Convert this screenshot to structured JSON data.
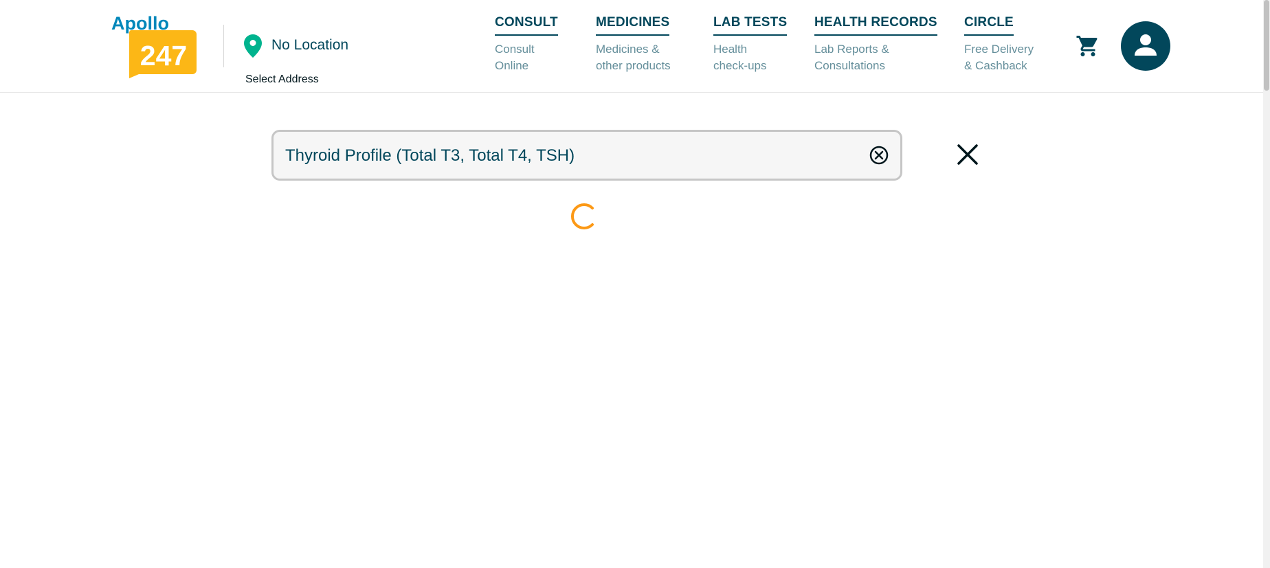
{
  "brand": {
    "logo_top": "Apollo",
    "logo_number": "247",
    "logo_colors": {
      "text": "#0087ba",
      "badge": "#fcb716"
    }
  },
  "location": {
    "icon": "location-pin-icon",
    "label": "No Location",
    "sub_label": "Select Address",
    "pin_color": "#00b38e"
  },
  "nav": {
    "items": [
      {
        "title": "CONSULT",
        "desc1": "Consult",
        "desc2": "Online"
      },
      {
        "title": "MEDICINES",
        "desc1": "Medicines &",
        "desc2": "other products"
      },
      {
        "title": "LAB TESTS",
        "desc1": "Health",
        "desc2": "check-ups"
      },
      {
        "title": "HEALTH RECORDS",
        "desc1": "Lab Reports &",
        "desc2": "Consultations"
      },
      {
        "title": "CIRCLE",
        "desc1": "Free Delivery",
        "desc2": "& Cashback"
      }
    ]
  },
  "header_actions": {
    "cart_icon": "cart-icon",
    "profile_icon": "user-icon"
  },
  "search": {
    "value": "Thyroid Profile (Total T3, Total T4, TSH)",
    "clear_icon": "clear-circle-icon",
    "close_icon": "close-icon"
  },
  "status": {
    "loading": true,
    "spinner_color": "#fc9916"
  },
  "colors": {
    "primary": "#02475b",
    "muted": "#658f9b"
  }
}
